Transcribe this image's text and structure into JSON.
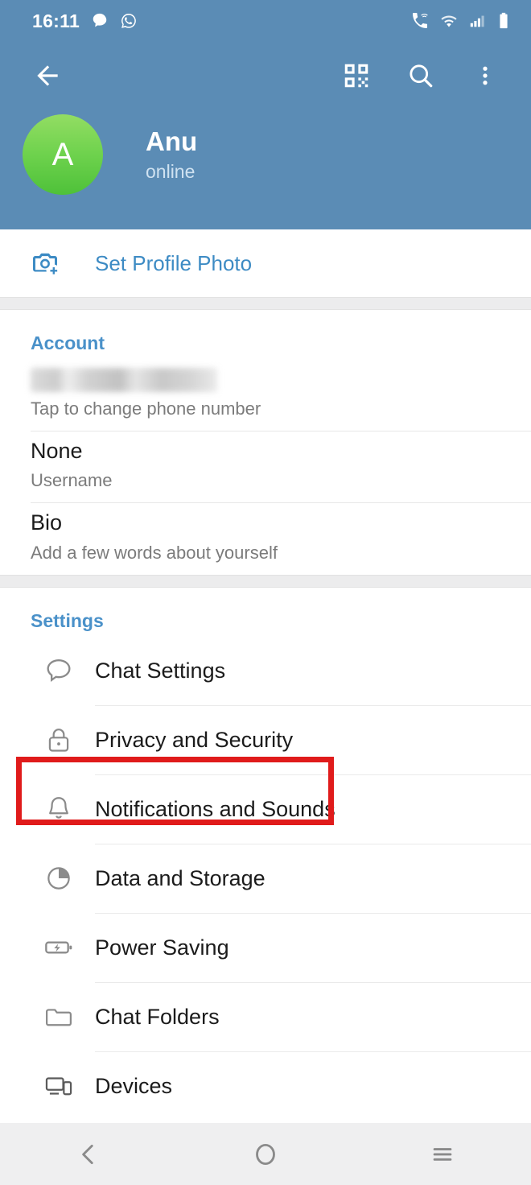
{
  "statusbar": {
    "time": "16:11",
    "left_icons": [
      "message-bubble-icon",
      "whatsapp-icon"
    ],
    "right_icons": [
      "wifi-calling-icon",
      "wifi-icon",
      "cellular-signal-icon",
      "battery-icon"
    ]
  },
  "toolbar": {
    "back": "back-arrow-icon",
    "qr": "qr-code-icon",
    "search": "search-icon",
    "more": "overflow-menu-icon"
  },
  "profile": {
    "avatar_initial": "A",
    "name": "Anu",
    "status": "online"
  },
  "set_photo": {
    "label": "Set Profile Photo",
    "icon": "camera-add-icon"
  },
  "account": {
    "title": "Account",
    "phone_value": "",
    "phone_sub": "Tap to change phone number",
    "username_value": "None",
    "username_sub": "Username",
    "bio_value": "Bio",
    "bio_sub": "Add a few words about yourself"
  },
  "settings": {
    "title": "Settings",
    "items": [
      {
        "label": "Chat Settings",
        "icon": "chat-bubble-icon"
      },
      {
        "label": "Privacy and Security",
        "icon": "lock-icon"
      },
      {
        "label": "Notifications and Sounds",
        "icon": "bell-icon"
      },
      {
        "label": "Data and Storage",
        "icon": "pie-chart-icon"
      },
      {
        "label": "Power Saving",
        "icon": "battery-bolt-icon"
      },
      {
        "label": "Chat Folders",
        "icon": "folder-icon"
      },
      {
        "label": "Devices",
        "icon": "devices-icon"
      }
    ]
  },
  "navbar": {
    "back": "nav-back-icon",
    "home": "nav-home-icon",
    "recents": "nav-recents-icon"
  },
  "colors": {
    "header_blue": "#5b8cb5",
    "accent_blue": "#4a91c9",
    "link_blue": "#3d8bc4",
    "highlight_red": "#e01b1b",
    "avatar_green_top": "#93dd63",
    "avatar_green_bottom": "#4ec139"
  }
}
